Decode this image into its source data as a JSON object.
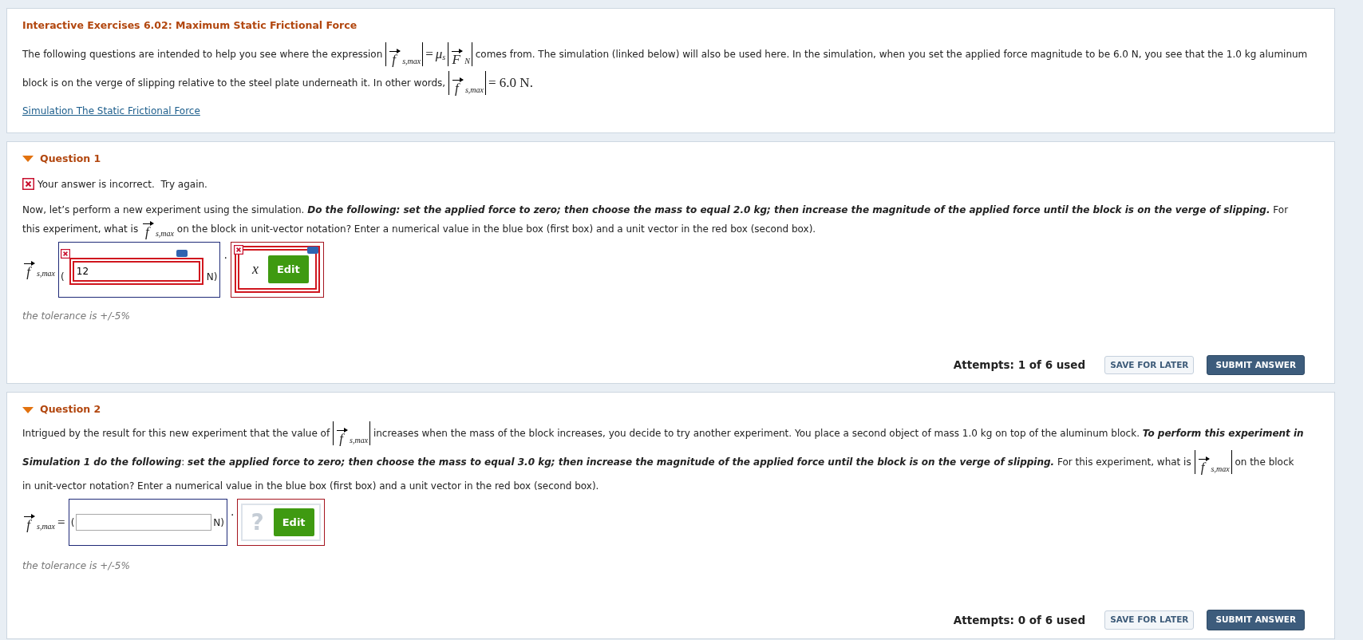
{
  "header": {
    "title": "Interactive Exercises 6.02: Maximum Static Frictional Force",
    "intro": [
      {
        "kind": "text",
        "text": "The following questions are intended to help you see where the expression "
      },
      {
        "kind": "math",
        "parts": [
          {
            "kind": "norm",
            "symbol": "f",
            "sub": "s,max"
          },
          {
            "kind": "op",
            "text": "="
          },
          {
            "kind": "sym",
            "symbol": "μ",
            "sub": "s"
          },
          {
            "kind": "norm",
            "symbol": "F",
            "sub": "N"
          }
        ]
      },
      {
        "kind": "text",
        "text": " comes from. The simulation (linked below) will also be used here. In the simulation, when you set the applied force magnitude to be 6.0 N, you see that the 1.0 kg aluminum block is on the verge of slipping relative to the steel plate underneath it. In other words, "
      },
      {
        "kind": "math",
        "parts": [
          {
            "kind": "norm",
            "symbol": "f",
            "sub": "s,max"
          },
          {
            "kind": "op",
            "text": "= 6.0 N."
          }
        ]
      }
    ],
    "link": "Simulation The Static Frictional Force"
  },
  "questions": [
    {
      "title": "Question 1",
      "expanded": true,
      "incorrect": true,
      "feedback": "Your answer is incorrect.  Try again.",
      "prompt": [
        {
          "kind": "text",
          "text": "Now, let’s perform a new experiment using the simulation. "
        },
        {
          "kind": "emph",
          "text": "Do the following: set the applied force to zero; then choose the mass to equal 2.0 kg; then increase the magnitude of the applied force until the block is on the verge of slipping."
        },
        {
          "kind": "text",
          "text": " For this experiment, what is "
        },
        {
          "kind": "math",
          "parts": [
            {
              "kind": "vec",
              "symbol": "f",
              "sub": "s,max"
            }
          ]
        },
        {
          "kind": "text",
          "text": " on the block in unit-vector notation? Enter a numerical value in the blue box (first box) and a unit vector in the red box (second box)."
        }
      ],
      "label": [
        {
          "kind": "vec",
          "symbol": "f",
          "sub": "s,max"
        }
      ],
      "open": "(",
      "value": "12",
      "unit": "N)",
      "dot": "·",
      "unit_vector": "x",
      "edit": "Edit",
      "tolerance": "the tolerance is +/-5%",
      "attempts": "Attempts: 1 of 6 used",
      "save": "SAVE FOR LATER",
      "submit": "SUBMIT ANSWER"
    },
    {
      "title": "Question 2",
      "expanded": true,
      "incorrect": false,
      "prompt": [
        {
          "kind": "text",
          "text": "Intrigued by the result for this new experiment that the value of "
        },
        {
          "kind": "math",
          "parts": [
            {
              "kind": "norm",
              "symbol": "f",
              "sub": "s,max"
            }
          ]
        },
        {
          "kind": "text",
          "text": " increases when the mass of the block increases, you decide to try another experiment. You place a second object of mass 1.0 kg on top of the aluminum block. "
        },
        {
          "kind": "emph",
          "text": "To perform this experiment in Simulation 1 do the following"
        },
        {
          "kind": "text",
          "text": ": "
        },
        {
          "kind": "emph",
          "text": "set the applied force to zero; then choose the mass to equal 3.0 kg; then increase the magnitude of the applied force until the block is on the verge of slipping."
        },
        {
          "kind": "text",
          "text": " For this experiment, what is "
        },
        {
          "kind": "math",
          "parts": [
            {
              "kind": "norm",
              "symbol": "f",
              "sub": "s,max"
            }
          ]
        },
        {
          "kind": "text",
          "text": " on the block in unit-vector notation? Enter a numerical value in the blue box (first box) and a unit vector in the red box (second box)."
        }
      ],
      "label": [
        {
          "kind": "vec",
          "symbol": "f",
          "sub": "s,max"
        },
        {
          "kind": "op",
          "text": "="
        }
      ],
      "open": "(",
      "unit": "N)",
      "dot": "·",
      "unit_placeholder": "?",
      "edit": "Edit",
      "tolerance": "the tolerance is +/-5%",
      "attempts": "Attempts: 0 of 6 used",
      "save": "SAVE FOR LATER",
      "submit": "SUBMIT ANSWER"
    }
  ]
}
